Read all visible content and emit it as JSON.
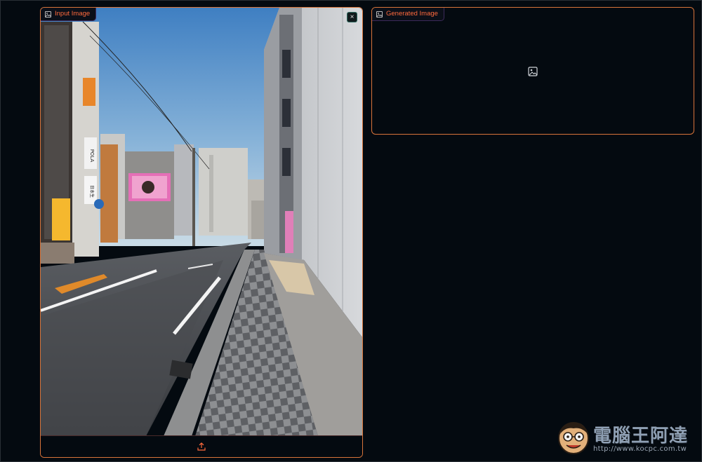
{
  "input_panel": {
    "label": "Input Image",
    "close_glyph": "×",
    "upload_icon": "upload-icon"
  },
  "generated_panel": {
    "label": "Generated Image",
    "placeholder_icon": "image-icon"
  },
  "photo": {
    "sign_vertical_1": "POLA",
    "sign_vertical_2": "日本生"
  },
  "watermark": {
    "title": "電腦王阿達",
    "url": "http://www.kocpc.com.tw"
  },
  "colors": {
    "accent_border": "#d8743a",
    "label_text": "#ff6a3d",
    "background": "#040a10"
  }
}
